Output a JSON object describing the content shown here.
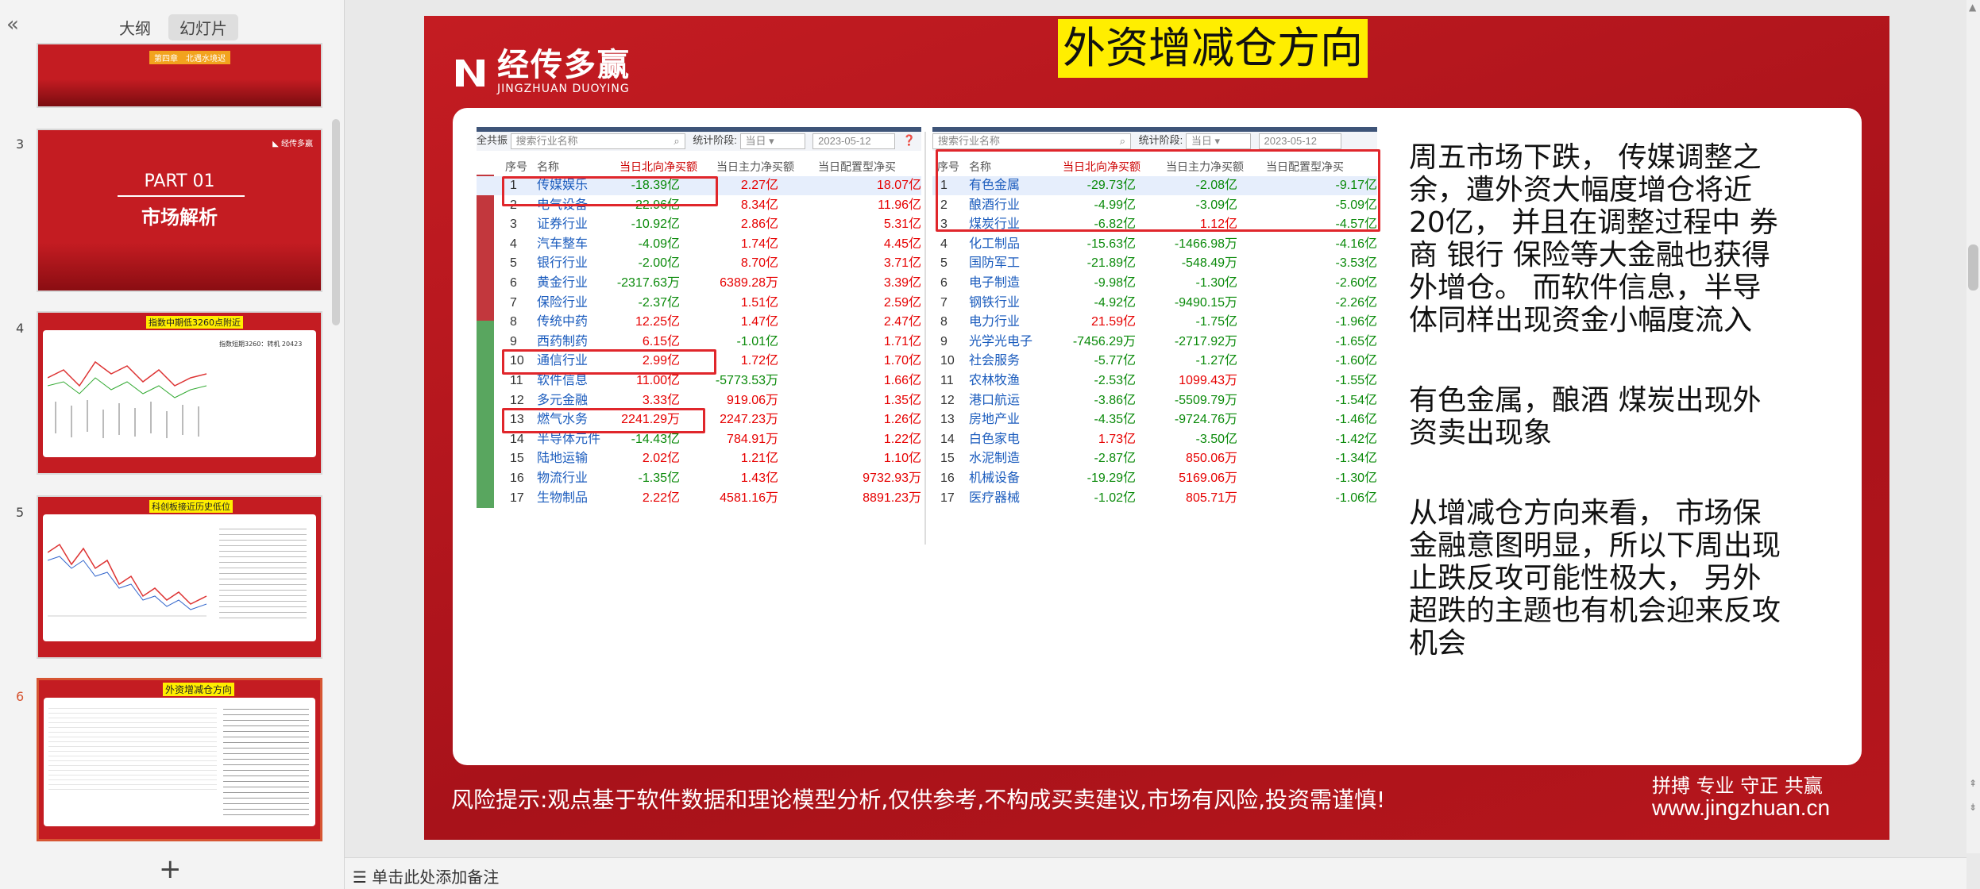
{
  "left_panel": {
    "collapse_icon": "double-chevron-left-icon",
    "tabs": [
      {
        "label": "大纲"
      },
      {
        "label": "幻灯片"
      }
    ],
    "thumbs": {
      "t2": {
        "chip": "第四章",
        "chip_text": "北遇水境迟"
      },
      "t3": {
        "part": "PART 01",
        "title": "市场解析"
      },
      "t4": {
        "title": "指数中期低3260点附近",
        "note": "指数短期3260：转机 20423"
      },
      "t5": {
        "title": "科创板接近历史低位"
      },
      "t6": {
        "title": "外资增减仓方向"
      }
    },
    "slide_numbers": [
      "3",
      "4",
      "5",
      "6"
    ],
    "add_slide_icon": "plus-icon"
  },
  "slide": {
    "title": "外资增减仓方向",
    "logo_cn": "经传多赢",
    "logo_en": "JINGZHUAN DUOYING",
    "risk": "风险提示:观点基于软件数据和理论模型分析,仅供参考,不构成买卖建议,市场有风险,投资需谨慎!",
    "slogan": "拼搏 专业 守正 共赢",
    "website": "www.jingzhuan.cn",
    "left_table": {
      "toolbar": {
        "all": "全共振",
        "search_placeholder": "搜索行业名称",
        "stat_label": "统计阶段:",
        "stat_value": "当日",
        "date": "2023-05-12"
      },
      "headers": [
        "序号",
        "名称",
        "当日北向净买额",
        "当日主力净买额",
        "当日配置型净买"
      ],
      "rows": [
        [
          "1",
          "传媒娱乐",
          "18.07亿",
          "-18.39亿",
          "2.27亿"
        ],
        [
          "2",
          "电气设备",
          "11.96亿",
          "-22.96亿",
          "8.34亿"
        ],
        [
          "3",
          "证券行业",
          "5.31亿",
          "-10.92亿",
          "2.86亿"
        ],
        [
          "4",
          "汽车整车",
          "4.45亿",
          "-4.09亿",
          "1.74亿"
        ],
        [
          "5",
          "银行行业",
          "3.71亿",
          "-2.00亿",
          "8.70亿"
        ],
        [
          "6",
          "黄金行业",
          "3.39亿",
          "-2317.63万",
          "6389.28万"
        ],
        [
          "7",
          "保险行业",
          "2.59亿",
          "-2.37亿",
          "1.51亿"
        ],
        [
          "8",
          "传统中药",
          "2.47亿",
          "12.25亿",
          "1.47亿"
        ],
        [
          "9",
          "西药制药",
          "1.71亿",
          "6.15亿",
          "-1.01亿"
        ],
        [
          "10",
          "通信行业",
          "1.70亿",
          "2.99亿",
          "1.72亿"
        ],
        [
          "11",
          "软件信息",
          "1.66亿",
          "11.00亿",
          "-5773.53万"
        ],
        [
          "12",
          "多元金融",
          "1.35亿",
          "3.33亿",
          "919.06万"
        ],
        [
          "13",
          "燃气水务",
          "1.26亿",
          "2241.29万",
          "2247.23万"
        ],
        [
          "14",
          "半导体元件",
          "1.22亿",
          "-14.43亿",
          "784.91万"
        ],
        [
          "15",
          "陆地运输",
          "1.10亿",
          "2.02亿",
          "1.21亿"
        ],
        [
          "16",
          "物流行业",
          "9732.93万",
          "-1.35亿",
          "1.43亿"
        ],
        [
          "17",
          "生物制品",
          "8891.23万",
          "2.22亿",
          "4581.16万"
        ]
      ]
    },
    "right_table": {
      "toolbar": {
        "search_placeholder": "搜索行业名称",
        "stat_label": "统计阶段:",
        "stat_value": "当日",
        "date": "2023-05-12"
      },
      "headers": [
        "序号",
        "名称",
        "当日北向净买额",
        "当日主力净买额",
        "当日配置型净买"
      ],
      "rows": [
        [
          "1",
          "有色金属",
          "-9.17亿",
          "-29.73亿",
          "-2.08亿"
        ],
        [
          "2",
          "酿酒行业",
          "-5.09亿",
          "-4.99亿",
          "-3.09亿"
        ],
        [
          "3",
          "煤炭行业",
          "-4.57亿",
          "-6.82亿",
          "1.12亿"
        ],
        [
          "4",
          "化工制品",
          "-4.16亿",
          "-15.63亿",
          "-1466.98万"
        ],
        [
          "5",
          "国防军工",
          "-3.53亿",
          "-21.89亿",
          "-548.49万"
        ],
        [
          "6",
          "电子制造",
          "-2.60亿",
          "-9.98亿",
          "-1.30亿"
        ],
        [
          "7",
          "钢铁行业",
          "-2.26亿",
          "-4.92亿",
          "-9490.15万"
        ],
        [
          "8",
          "电力行业",
          "-1.96亿",
          "21.59亿",
          "-1.75亿"
        ],
        [
          "9",
          "光学光电子",
          "-1.65亿",
          "-7456.29万",
          "-2717.92万"
        ],
        [
          "10",
          "社会服务",
          "-1.60亿",
          "-5.77亿",
          "-1.27亿"
        ],
        [
          "11",
          "农林牧渔",
          "-1.55亿",
          "-2.53亿",
          "1099.43万"
        ],
        [
          "12",
          "港口航运",
          "-1.54亿",
          "-3.86亿",
          "-5509.79万"
        ],
        [
          "13",
          "房地产业",
          "-1.46亿",
          "-4.35亿",
          "-9724.76万"
        ],
        [
          "14",
          "白色家电",
          "-1.42亿",
          "1.73亿",
          "-3.50亿"
        ],
        [
          "15",
          "水泥制造",
          "-1.34亿",
          "-2.87亿",
          "850.06万"
        ],
        [
          "16",
          "机械设备",
          "-1.30亿",
          "-19.29亿",
          "5169.06万"
        ],
        [
          "17",
          "医疗器械",
          "-1.06亿",
          "-1.02亿",
          "805.71万"
        ]
      ]
    },
    "side_text": [
      "周五市场下跌， 传媒调整之余，遭外资大幅度增仓将近20亿， 并且在调整过程中 券商 银行 保险等大金融也获得外增仓。 而软件信息，半导体同样出现资金小幅度流入",
      "有色金属，酿酒  煤炭出现外资卖出现象",
      "从增减仓方向来看， 市场保金融意图明显，所以下周出现止跌反攻可能性极大， 另外超跌的主题也有机会迎来反攻机会"
    ]
  },
  "notes": {
    "placeholder": "单击此处添加备注",
    "icon": "notes-icon"
  },
  "colors": {
    "slide_red": "#b8141b",
    "title_yellow": "#ffee00",
    "positive": "#e60000",
    "negative": "#0a8a0a",
    "highlight": "#e0262b",
    "selected_thumb": "#d65532"
  }
}
